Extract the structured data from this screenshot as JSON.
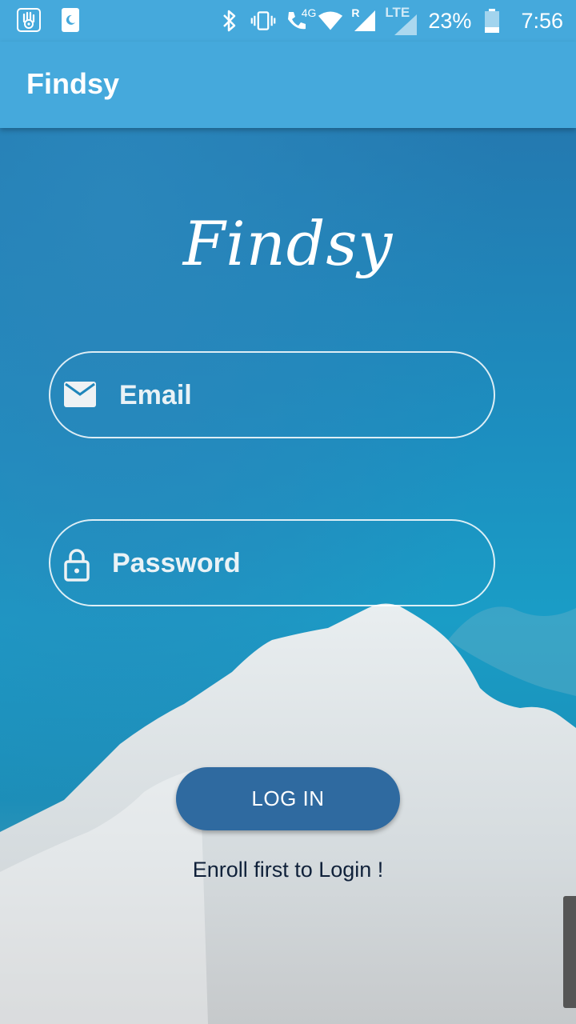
{
  "status_bar": {
    "left_icons": [
      "hand-icon",
      "moon-notification-icon"
    ],
    "right_icons": [
      "bluetooth-icon",
      "vibrate-icon",
      "volte-call-icon",
      "wifi-icon",
      "signal-roaming-icon",
      "lte-signal-icon",
      "battery-icon"
    ],
    "network_label": "4G",
    "roaming_label": "R",
    "lte_label": "LTE",
    "battery": "23%",
    "time": "7:56"
  },
  "app_bar": {
    "title": "Findsy"
  },
  "logo": {
    "text": "Findsy"
  },
  "form": {
    "email": {
      "placeholder": "Email",
      "icon": "mail-icon"
    },
    "password": {
      "placeholder": "Password",
      "icon": "lock-icon"
    },
    "login_label": "LOG IN",
    "enroll_text": "Enroll first to Login !"
  },
  "colors": {
    "app_bar": "#45a9dc",
    "button": "#2f6aa0",
    "enroll_text": "#10213a"
  }
}
